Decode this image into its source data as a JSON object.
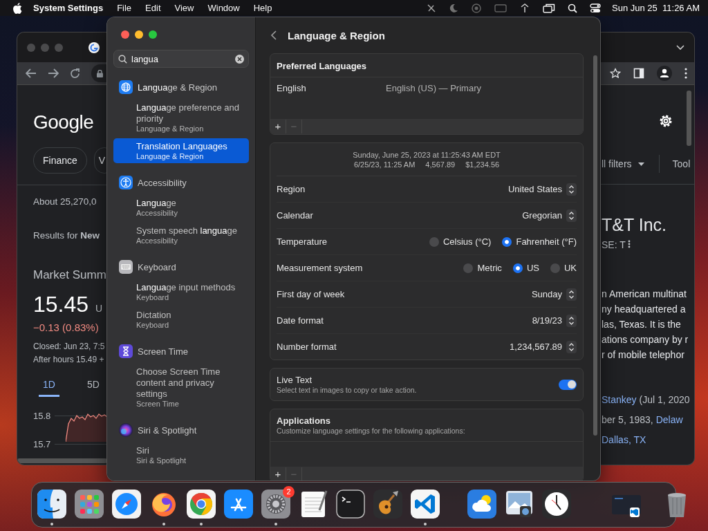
{
  "menu_bar": {
    "app_name": "System Settings",
    "menus": [
      "File",
      "Edit",
      "View",
      "Window",
      "Help"
    ],
    "date": "Sun Jun 25",
    "time": "11:26 AM"
  },
  "browser": {
    "left": {
      "logo": "Google",
      "chips": [
        "Finance",
        "V"
      ],
      "result_count": "About 25,270,0",
      "results_for": "Results for **New**",
      "market_title": "Market Summ",
      "price": "15.45",
      "currency": "U",
      "change": "−0.13 (0.83%)",
      "closed": "Closed: Jun 23, 7:5",
      "after_hours": "After hours 15.49 +",
      "ranges": [
        {
          "label": "1D",
          "selected": true
        },
        {
          "label": "5D",
          "selected": false
        }
      ],
      "chart_ticks": [
        "15.8",
        "15.7"
      ]
    },
    "right": {
      "filters": "ll filters",
      "tools": "Tool",
      "company": "T&T Inc.",
      "ticker": "SE: T",
      "description": [
        "n American multinat",
        "ny headquartered a",
        "las, Texas. It is the",
        "ations company by r",
        "r of mobile telephor"
      ],
      "facts": [
        [
          {
            "text": "Stankey",
            "link": true
          },
          {
            "text": "(Jul 1, 2020",
            "link": false
          }
        ],
        [
          {
            "text": "ber 5, 1983,",
            "link": false
          },
          {
            "text": "Delaw",
            "link": true
          }
        ],
        [
          {
            "text": "Dallas, TX",
            "link": true
          }
        ]
      ]
    }
  },
  "settings": {
    "search": {
      "value": "langua"
    },
    "sidebar": [
      {
        "category": "**Langua**ge & Region",
        "kind": "globe",
        "results": [
          {
            "title": "**Langua**ge preference and priority",
            "subtitle": "Language & Region",
            "selected": false
          },
          {
            "title": "Translation **Langua**ges",
            "subtitle": "Language & Region",
            "selected": true
          }
        ]
      },
      {
        "category": "Accessibility",
        "kind": "accessibility",
        "results": [
          {
            "title": "**Langua**ge",
            "subtitle": "Accessibility",
            "selected": false
          },
          {
            "title": "System speech **langua**ge",
            "subtitle": "Accessibility",
            "selected": false
          }
        ]
      },
      {
        "category": "Keyboard",
        "kind": "keyboard",
        "results": [
          {
            "title": "**Langua**ge input methods",
            "subtitle": "Keyboard",
            "selected": false
          },
          {
            "title": "Dictation",
            "subtitle": "Keyboard",
            "selected": false
          }
        ]
      },
      {
        "category": "Screen Time",
        "kind": "hourglass",
        "results": [
          {
            "title": "Choose Screen Time content and privacy settings",
            "subtitle": "Screen Time",
            "selected": false
          }
        ]
      },
      {
        "category": "Siri & Spotlight",
        "kind": "siri",
        "results": [
          {
            "title": "Siri",
            "subtitle": "Siri & Spotlight",
            "selected": false
          }
        ]
      }
    ],
    "title": "Language & Region",
    "preferred_languages": {
      "heading": "Preferred Languages",
      "languages": [
        {
          "name": "English",
          "detail": "English (US) — Primary"
        }
      ],
      "buttons": [
        {
          "label": "+",
          "disabled": false
        },
        {
          "label": "−",
          "disabled": true
        }
      ]
    },
    "format_preview": {
      "long": "Sunday, June 25, 2023 at 11:25:43 AM EDT",
      "short": [
        "6/25/23, 11:25 AM",
        "4,567.89",
        "$1,234.56"
      ]
    },
    "format_rows": [
      {
        "kind": "popup",
        "label": "Region",
        "value": "United States"
      },
      {
        "kind": "popup",
        "label": "Calendar",
        "value": "Gregorian"
      },
      {
        "kind": "radio",
        "label": "Temperature",
        "options": [
          {
            "label": "Celsius (°C)",
            "selected": false
          },
          {
            "label": "Fahrenheit (°F)",
            "selected": true
          }
        ]
      },
      {
        "kind": "radio",
        "label": "Measurement system",
        "options": [
          {
            "label": "Metric",
            "selected": false
          },
          {
            "label": "US",
            "selected": true
          },
          {
            "label": "UK",
            "selected": false
          }
        ]
      },
      {
        "kind": "popup",
        "label": "First day of week",
        "value": "Sunday"
      },
      {
        "kind": "popup",
        "label": "Date format",
        "value": "8/19/23"
      },
      {
        "kind": "popup",
        "label": "Number format",
        "value": "1,234,567.89"
      }
    ],
    "live_text": {
      "title": "Live Text",
      "description": "Select text in images to copy or take action.",
      "on": true
    },
    "applications": {
      "title": "Applications",
      "description": "Customize language settings for the following applications:",
      "buttons": [
        {
          "label": "+",
          "disabled": false
        },
        {
          "label": "−",
          "disabled": true
        }
      ]
    }
  },
  "dock": {
    "items": [
      {
        "kind": "finder",
        "running": true
      },
      {
        "kind": "launchpad",
        "running": false
      },
      {
        "kind": "safari",
        "running": false
      },
      {
        "kind": "firefox",
        "running": true
      },
      {
        "kind": "chrome",
        "running": true
      },
      {
        "kind": "appstore",
        "running": false
      },
      {
        "kind": "settings",
        "running": true,
        "badge": "2"
      },
      {
        "kind": "textedit",
        "running": false
      },
      {
        "kind": "terminal",
        "running": false
      },
      {
        "kind": "guitar",
        "running": false
      },
      {
        "kind": "vscode",
        "running": true
      },
      {
        "kind": "separator"
      },
      {
        "kind": "weather",
        "running": false
      },
      {
        "kind": "preview",
        "running": false
      },
      {
        "kind": "clock",
        "running": false
      },
      {
        "kind": "separator"
      },
      {
        "kind": "minimized",
        "running": false
      },
      {
        "kind": "trash",
        "running": false
      }
    ]
  }
}
